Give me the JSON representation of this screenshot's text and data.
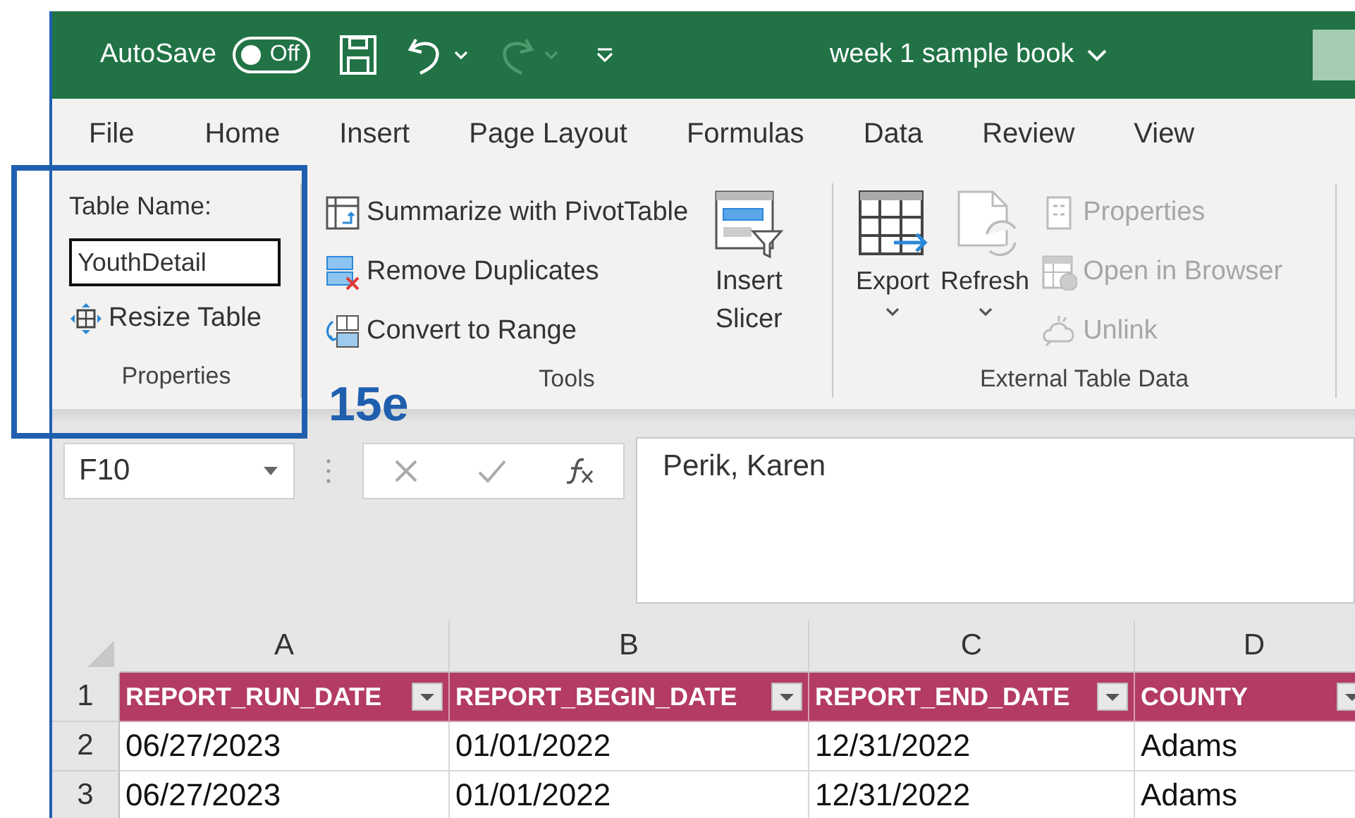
{
  "title_bar": {
    "autosave_label": "AutoSave",
    "autosave_toggle": {
      "label": "Off",
      "on": false
    },
    "redo_disabled": true,
    "document_title": "week 1 sample book"
  },
  "menu_tabs": [
    {
      "label": "File",
      "selected": false
    },
    {
      "label": "Home",
      "selected": false
    },
    {
      "label": "Insert",
      "selected": false
    },
    {
      "label": "Page Layout",
      "selected": false
    },
    {
      "label": "Formulas",
      "selected": false
    },
    {
      "label": "Data",
      "selected": false
    },
    {
      "label": "Review",
      "selected": false
    },
    {
      "label": "View",
      "selected": false
    }
  ],
  "ribbon": {
    "properties_group": {
      "table_name_label": "Table Name:",
      "table_name": "YouthDetail",
      "resize_button": "Resize Table",
      "label": "Properties"
    },
    "tools_group": {
      "items": [
        {
          "kind": "pivot",
          "label": "Summarize with PivotTable"
        },
        {
          "kind": "duplicates",
          "label": "Remove Duplicates"
        },
        {
          "kind": "convert",
          "label": "Convert to Range"
        }
      ],
      "slicer_lines": [
        "Insert",
        "Slicer"
      ],
      "label": "Tools"
    },
    "external_group": {
      "large_buttons": [
        {
          "kind": "export",
          "label": "Export"
        },
        {
          "kind": "refresh",
          "label": "Refresh"
        }
      ],
      "small_buttons": [
        {
          "kind": "properties",
          "label": "Properties",
          "disabled": true
        },
        {
          "kind": "browser",
          "label": "Open in Browser",
          "disabled": true
        },
        {
          "kind": "unlink",
          "label": "Unlink",
          "disabled": true
        }
      ],
      "label": "External Table Data"
    }
  },
  "formula_bar": {
    "name_box": "F10",
    "formula": "Perik, Karen"
  },
  "sheet": {
    "columns": [
      "A",
      "B",
      "C",
      "D"
    ],
    "rows": [
      {
        "number": "1",
        "header": true,
        "cells": [
          "REPORT_RUN_DATE",
          "REPORT_BEGIN_DATE",
          "REPORT_END_DATE",
          "COUNTY"
        ]
      },
      {
        "number": "2",
        "header": false,
        "cells": [
          "06/27/2023",
          "01/01/2022",
          "12/31/2022",
          "Adams"
        ]
      },
      {
        "number": "3",
        "header": false,
        "cells": [
          "06/27/2023",
          "01/01/2022",
          "12/31/2022",
          "Adams"
        ]
      }
    ]
  },
  "annotation": {
    "label": "15e"
  }
}
